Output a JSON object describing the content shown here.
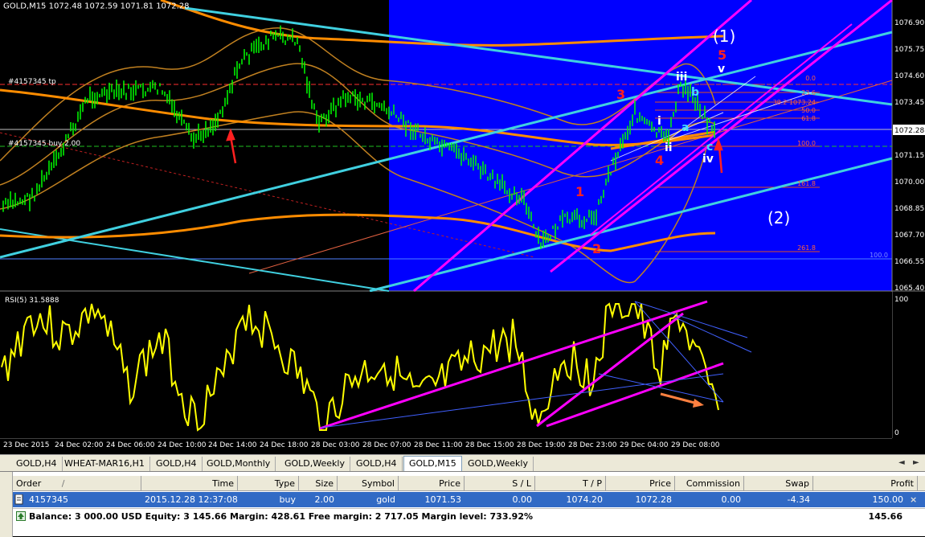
{
  "chart": {
    "title": "GOLD,M15  1072.48 1072.59 1071.81 1072.28",
    "order_tp_label": "#4157345 tp",
    "order_buy_label": "#4157345 buy 2.00",
    "price_scale": [
      "1076.90",
      "1075.75",
      "1074.60",
      "1073.45",
      "1072.28",
      "1071.15",
      "1070.00",
      "1068.85",
      "1067.70",
      "1066.55",
      "1065.40"
    ],
    "current_price": "1072.28",
    "time_axis": [
      "23 Dec 2015",
      "24 Dec 02:00",
      "24 Dec 06:00",
      "24 Dec 10:00",
      "24 Dec 14:00",
      "24 Dec 18:00",
      "28 Dec 03:00",
      "28 Dec 07:00",
      "28 Dec 11:00",
      "28 Dec 15:00",
      "28 Dec 19:00",
      "28 Dec 23:00",
      "29 Dec 04:00",
      "29 Dec 08:00"
    ],
    "fib_levels": [
      "0.0",
      "23.6",
      "38.2 1073.24",
      "50.0",
      "61.8",
      "100.0",
      "161.8",
      "261.8",
      "100.0"
    ],
    "wave_labels": {
      "big_1": "(1)",
      "big_2": "(2)",
      "red": [
        "1",
        "2",
        "3",
        "4",
        "5"
      ],
      "white": [
        "i",
        "ii",
        "iii",
        "iv",
        "v"
      ],
      "abc": [
        "a",
        "b",
        "c"
      ]
    },
    "rsi_label": "RSI(5) 31.5888",
    "rsi_scale": [
      "100",
      "0"
    ],
    "colors": {
      "background": "#000000",
      "highlight": "#0000ff",
      "candles": "#00ff00",
      "bollinger": "#c08020",
      "ma": "#ff8c00",
      "channel_cyan": "#40d0e0",
      "channel_magenta": "#ff00ff",
      "rsi": "#ffff00",
      "wave_red": "#ff2020"
    }
  },
  "tabs": {
    "items": [
      "GOLD,H4",
      "WHEAT-MAR16,H1",
      "GOLD,H4",
      "GOLD,Monthly",
      "GOLD,Weekly",
      "GOLD,H4",
      "GOLD,M15",
      "GOLD,Weekly"
    ],
    "active_index": 6,
    "nav_left": "◄",
    "nav_right": "►"
  },
  "terminal": {
    "columns": [
      "Order",
      "/",
      "Time",
      "Type",
      "Size",
      "Symbol",
      "Price",
      "S / L",
      "T / P",
      "Price",
      "Commission",
      "Swap",
      "Profit"
    ],
    "order": {
      "id": "4157345",
      "time": "2015.12.28 12:37:08",
      "type": "buy",
      "size": "2.00",
      "symbol": "gold",
      "price": "1071.53",
      "sl": "0.00",
      "tp": "1074.20",
      "cur_price": "1072.28",
      "commission": "0.00",
      "swap": "-4.34",
      "profit": "150.00"
    },
    "balance_line": "Balance: 3 000.00 USD  Equity: 3 145.66  Margin: 428.61  Free margin: 2 717.05  Margin level: 733.92%",
    "balance_profit": "145.66",
    "close_icon": "×"
  }
}
